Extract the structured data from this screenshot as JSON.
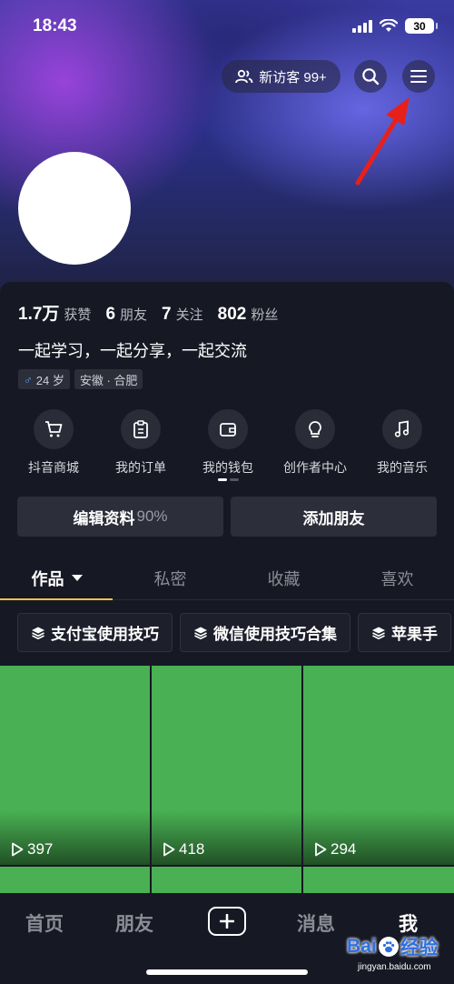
{
  "status_bar": {
    "time": "18:43",
    "battery": "30"
  },
  "header": {
    "visitors_label": "新访客 99+"
  },
  "profile": {
    "stats": [
      {
        "value": "1.7万",
        "label": "获赞"
      },
      {
        "value": "6",
        "label": "朋友"
      },
      {
        "value": "7",
        "label": "关注"
      },
      {
        "value": "802",
        "label": "粉丝"
      }
    ],
    "bio": "一起学习，一起分享，一起交流",
    "gender_symbol": "♂",
    "age": "24 岁",
    "location": "安徽 · 合肥"
  },
  "quick_actions": [
    {
      "label": "抖音商城",
      "icon": "cart-icon"
    },
    {
      "label": "我的订单",
      "icon": "order-icon"
    },
    {
      "label": "我的钱包",
      "icon": "wallet-icon"
    },
    {
      "label": "创作者中心",
      "icon": "lightbulb-icon"
    },
    {
      "label": "我的音乐",
      "icon": "music-icon"
    }
  ],
  "buttons": {
    "edit_profile": "编辑资料",
    "edit_profile_pct": "90%",
    "add_friend": "添加朋友"
  },
  "tabs": [
    "作品",
    "私密",
    "收藏",
    "喜欢"
  ],
  "collections": [
    "支付宝使用技巧",
    "微信使用技巧合集",
    "苹果手"
  ],
  "videos": [
    {
      "plays": "397"
    },
    {
      "plays": "418"
    },
    {
      "plays": "294"
    }
  ],
  "bottom_nav": {
    "home": "首页",
    "friends": "朋友",
    "messages": "消息",
    "me": "我"
  },
  "watermark": {
    "brand_left": "Bai",
    "brand_right": "经验",
    "url": "jingyan.baidu.com"
  },
  "colors": {
    "tab_indicator": "#f2c54b",
    "video_tile": "#49b153",
    "arrow": "#e8201a"
  }
}
